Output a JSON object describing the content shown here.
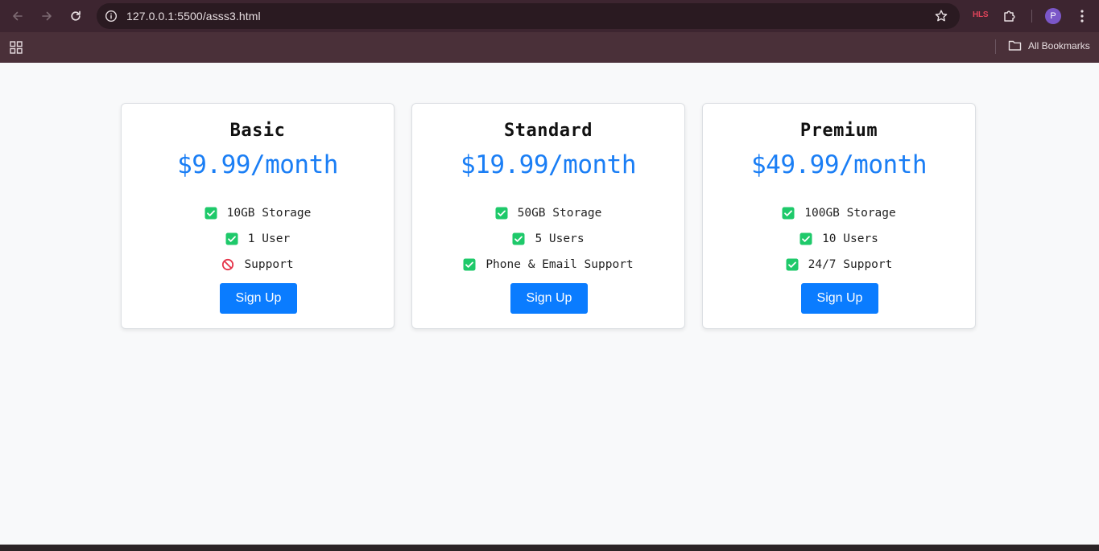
{
  "browser": {
    "url": "127.0.0.1:5500/asss3.html",
    "extension_badge": "HLS",
    "profile_initial": "P",
    "bookmarks_folder_label": "All Bookmarks"
  },
  "plans": [
    {
      "name": "Basic",
      "price": "$9.99/month",
      "features": [
        {
          "text": "10GB Storage",
          "icon": "check-icon"
        },
        {
          "text": "1 User",
          "icon": "check-icon"
        },
        {
          "text": "Support",
          "icon": "prohibited-icon"
        }
      ],
      "button_label": "Sign Up"
    },
    {
      "name": "Standard",
      "price": "$19.99/month",
      "features": [
        {
          "text": "50GB Storage",
          "icon": "check-icon"
        },
        {
          "text": "5 Users",
          "icon": "check-icon"
        },
        {
          "text": "Phone & Email Support",
          "icon": "check-icon"
        }
      ],
      "button_label": "Sign Up"
    },
    {
      "name": "Premium",
      "price": "$49.99/month",
      "features": [
        {
          "text": "100GB Storage",
          "icon": "check-icon"
        },
        {
          "text": "10 Users",
          "icon": "check-icon"
        },
        {
          "text": "24/7 Support",
          "icon": "check-icon"
        }
      ],
      "button_label": "Sign Up"
    }
  ],
  "colors": {
    "accent": "#1a7ef5",
    "button": "#0a7cff",
    "check": "#1ec96a",
    "prohibited": "#e5354a"
  }
}
